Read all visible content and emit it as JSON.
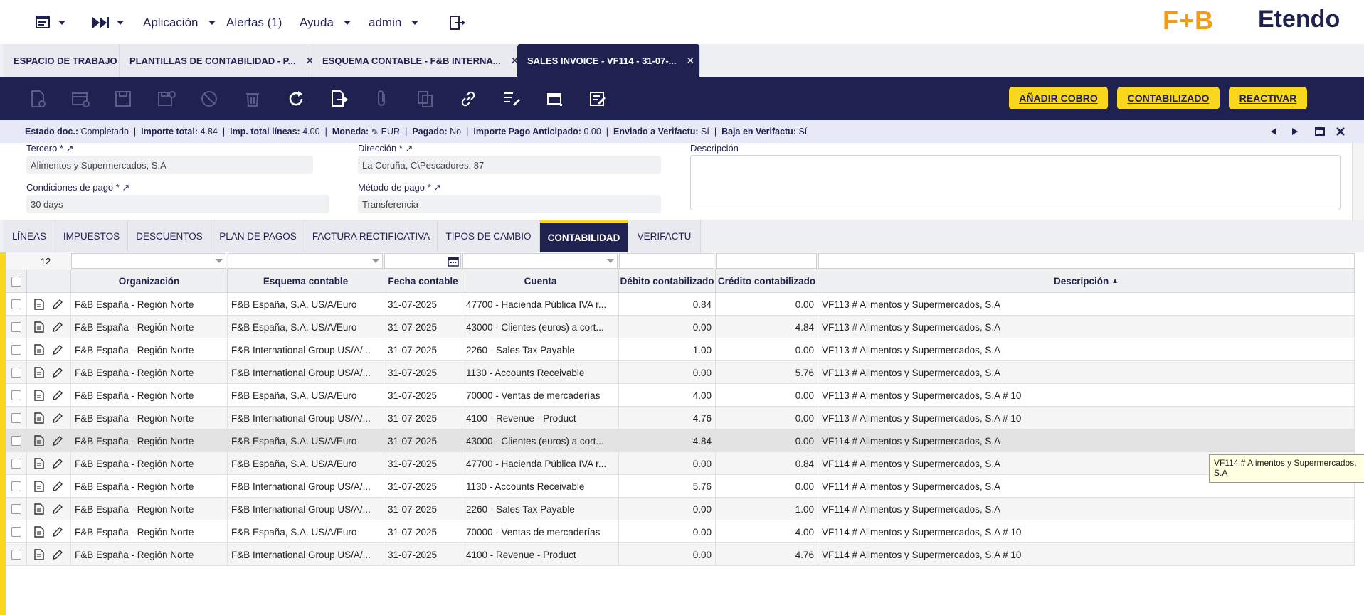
{
  "topbar": {
    "menu_app": "Aplicación",
    "menu_alerts": "Alertas (1)",
    "menu_help": "Ayuda",
    "menu_user": "admin",
    "logo_fb": "F+B",
    "logo_etendo": "Etendo"
  },
  "window_tabs": [
    {
      "label": "ESPACIO DE TRABAJO"
    },
    {
      "label": "PLANTILLAS DE CONTABILIDAD - P..."
    },
    {
      "label": "ESQUEMA CONTABLE - F&B INTERNA..."
    },
    {
      "label": "SALES INVOICE - VF114 - 31-07-..."
    }
  ],
  "toolbar": {
    "btn_add_payment": "AÑADIR COBRO",
    "btn_posted": "CONTABILIZADO",
    "btn_reactivate": "REACTIVAR"
  },
  "status": {
    "estado_label": "Estado doc.:",
    "estado_value": "Completado",
    "importe_label": "Importe total:",
    "importe_value": "4.84",
    "lineas_label": "Imp. total líneas:",
    "lineas_value": "4.00",
    "moneda_label": "Moneda:",
    "moneda_value": "EUR",
    "pagado_label": "Pagado:",
    "pagado_value": "No",
    "anticipado_label": "Importe Pago Anticipado:",
    "anticipado_value": "0.00",
    "verifactu_label": "Enviado a Verifactu:",
    "verifactu_value": "Sí",
    "baja_label": "Baja en Verifactu:",
    "baja_value": "Sí"
  },
  "form": {
    "tercero_label": "Tercero *",
    "tercero_value": "Alimentos y Supermercados, S.A",
    "direccion_label": "Dirección *",
    "direccion_value": "La Coruña, C\\Pescadores, 87",
    "descripcion_label": "Descripción",
    "condiciones_label": "Condiciones de pago *",
    "condiciones_value": "30 days",
    "metodo_label": "Método de pago *",
    "metodo_value": "Transferencia"
  },
  "sub_tabs": [
    {
      "label": "LÍNEAS"
    },
    {
      "label": "IMPUESTOS"
    },
    {
      "label": "DESCUENTOS"
    },
    {
      "label": "PLAN DE PAGOS"
    },
    {
      "label": "FACTURA RECTIFICATIVA"
    },
    {
      "label": "TIPOS DE CAMBIO"
    },
    {
      "label": "CONTABILIDAD"
    },
    {
      "label": "VERIFACTU"
    }
  ],
  "grid": {
    "row_count": "12",
    "columns": {
      "org": "Organización",
      "schema": "Esquema contable",
      "date": "Fecha contable",
      "account": "Cuenta",
      "debit": "Débito contabilizado",
      "credit": "Crédito contabilizado",
      "desc": "Descripción",
      "sort_indicator": "▲"
    },
    "rows": [
      {
        "org": "F&B España - Región Norte",
        "schema": "F&B España, S.A. US/A/Euro",
        "date": "31-07-2025",
        "account": "47700 - Hacienda Pública IVA r...",
        "debit": "0.84",
        "credit": "0.00",
        "desc": "VF113 # Alimentos y Supermercados, S.A"
      },
      {
        "org": "F&B España - Región Norte",
        "schema": "F&B España, S.A. US/A/Euro",
        "date": "31-07-2025",
        "account": "43000 - Clientes (euros) a cort...",
        "debit": "0.00",
        "credit": "4.84",
        "desc": "VF113 # Alimentos y Supermercados, S.A"
      },
      {
        "org": "F&B España - Región Norte",
        "schema": "F&B International Group US/A/...",
        "date": "31-07-2025",
        "account": "2260 - Sales Tax Payable",
        "debit": "1.00",
        "credit": "0.00",
        "desc": "VF113 # Alimentos y Supermercados, S.A"
      },
      {
        "org": "F&B España - Región Norte",
        "schema": "F&B International Group US/A/...",
        "date": "31-07-2025",
        "account": "1130 - Accounts Receivable",
        "debit": "0.00",
        "credit": "5.76",
        "desc": "VF113 # Alimentos y Supermercados, S.A"
      },
      {
        "org": "F&B España - Región Norte",
        "schema": "F&B España, S.A. US/A/Euro",
        "date": "31-07-2025",
        "account": "70000 - Ventas de mercaderías",
        "debit": "4.00",
        "credit": "0.00",
        "desc": "VF113 # Alimentos y Supermercados, S.A # 10"
      },
      {
        "org": "F&B España - Región Norte",
        "schema": "F&B International Group US/A/...",
        "date": "31-07-2025",
        "account": "4100 - Revenue - Product",
        "debit": "4.76",
        "credit": "0.00",
        "desc": "VF113 # Alimentos y Supermercados, S.A # 10"
      },
      {
        "org": "F&B España - Región Norte",
        "schema": "F&B España, S.A. US/A/Euro",
        "date": "31-07-2025",
        "account": "43000 - Clientes (euros) a cort...",
        "debit": "4.84",
        "credit": "0.00",
        "desc": "VF114 # Alimentos y Supermercados, S.A"
      },
      {
        "org": "F&B España - Región Norte",
        "schema": "F&B España, S.A. US/A/Euro",
        "date": "31-07-2025",
        "account": "47700 - Hacienda Pública IVA r...",
        "debit": "0.00",
        "credit": "0.84",
        "desc": "VF114 # Alimentos y Supermercados, S.A"
      },
      {
        "org": "F&B España - Región Norte",
        "schema": "F&B International Group US/A/...",
        "date": "31-07-2025",
        "account": "1130 - Accounts Receivable",
        "debit": "5.76",
        "credit": "0.00",
        "desc": "VF114 # Alimentos y Supermercados, S.A"
      },
      {
        "org": "F&B España - Región Norte",
        "schema": "F&B International Group US/A/...",
        "date": "31-07-2025",
        "account": "2260 - Sales Tax Payable",
        "debit": "0.00",
        "credit": "1.00",
        "desc": "VF114 # Alimentos y Supermercados, S.A"
      },
      {
        "org": "F&B España - Región Norte",
        "schema": "F&B España, S.A. US/A/Euro",
        "date": "31-07-2025",
        "account": "70000 - Ventas de mercaderías",
        "debit": "0.00",
        "credit": "4.00",
        "desc": "VF114 # Alimentos y Supermercados, S.A # 10"
      },
      {
        "org": "F&B España - Región Norte",
        "schema": "F&B International Group US/A/...",
        "date": "31-07-2025",
        "account": "4100 - Revenue - Product",
        "debit": "0.00",
        "credit": "4.76",
        "desc": "VF114 # Alimentos y Supermercados, S.A # 10"
      }
    ]
  },
  "tooltip": {
    "text": "VF114 # Alimentos y Supermercados, S.A"
  },
  "colors": {
    "navy": "#1f2150",
    "accent_yellow": "#f9d71c",
    "logo_orange": "#f39c12"
  }
}
